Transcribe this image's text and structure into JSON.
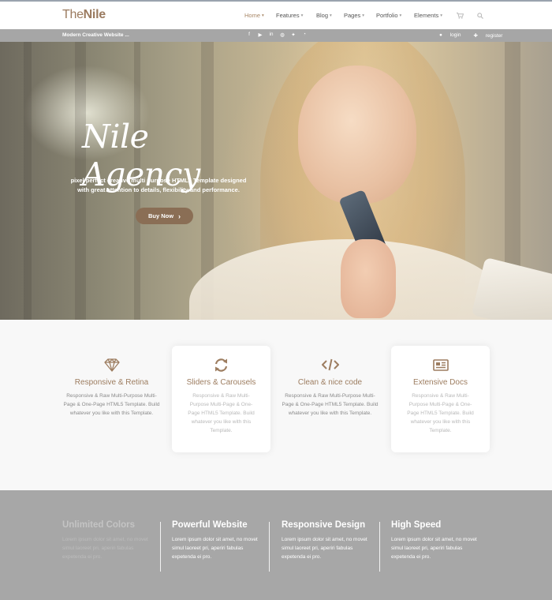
{
  "header": {
    "logo_light": "The",
    "logo_bold": "Nile",
    "nav": [
      {
        "label": "Home",
        "active": true
      },
      {
        "label": "Features",
        "active": false
      },
      {
        "label": "Blog",
        "active": false
      },
      {
        "label": "Pages",
        "active": false
      },
      {
        "label": "Portfolio",
        "active": false
      },
      {
        "label": "Elements",
        "active": false
      }
    ],
    "cart_icon": "cart-icon",
    "search_icon": "search-icon"
  },
  "subbar": {
    "tagline": "Modern Creative Website ...",
    "social": [
      "facebook-icon",
      "youtube-icon",
      "linkedin-icon",
      "dribbble-icon",
      "twitter-icon",
      "rss-icon"
    ],
    "login": "login",
    "register": "register"
  },
  "hero": {
    "title": "Nile Agency",
    "subtitle_line1": "pixel perfect creative multi purpose HTML5 Template designed",
    "subtitle_line2": "with great attention to details, flexibility and performance.",
    "button": "Buy Now"
  },
  "features": [
    {
      "icon": "diamond-icon",
      "title": "Responsive & Retina",
      "desc": "Responsive & Raw Multi-Purpose Multi-Page & One-Page HTML5 Template. Build whatever you like with this Template.",
      "raised": false
    },
    {
      "icon": "refresh-icon",
      "title": "Sliders & Carousels",
      "desc": "Responsive & Raw Multi-Purpose Multi-Page & One-Page HTML5 Template. Build whatever you like with this Template.",
      "raised": true
    },
    {
      "icon": "code-icon",
      "title": "Clean & nice code",
      "desc": "Responsive & Raw Multi-Purpose Multi-Page & One-Page HTML5 Template. Build whatever you like with this Template.",
      "raised": false
    },
    {
      "icon": "newspaper-icon",
      "title": "Extensive Docs",
      "desc": "Responsive & Raw Multi-Purpose Multi-Page & One-Page HTML5 Template. Build whatever you like with this Template.",
      "raised": true
    }
  ],
  "stats": [
    {
      "title": "Unlimited Colors",
      "text": "Lorem ipsum dolor sit amet, no movet simul laoreet pri, aperiri fabulas expetenda ei pro.",
      "dim": true
    },
    {
      "title": "Powerful Website",
      "text": "Lorem ipsum dolor sit amet, no movet simul laoreet pri, aperiri fabulas expetenda ei pro.",
      "dim": false
    },
    {
      "title": "Responsive Design",
      "text": "Lorem ipsum dolor sit amet, no movet simul laoreet pri, aperiri fabulas expetenda ei pro.",
      "dim": false
    },
    {
      "title": "High Speed",
      "text": "Lorem ipsum dolor sit amet, no movet simul laoreet pri, aperiri fabulas expetenda ei pro.",
      "dim": false
    }
  ],
  "colors": {
    "accent": "#9d7d60",
    "button": "#8a6e55",
    "subbar": "#a6a6a6",
    "stats_bg": "#a7a7a7"
  }
}
